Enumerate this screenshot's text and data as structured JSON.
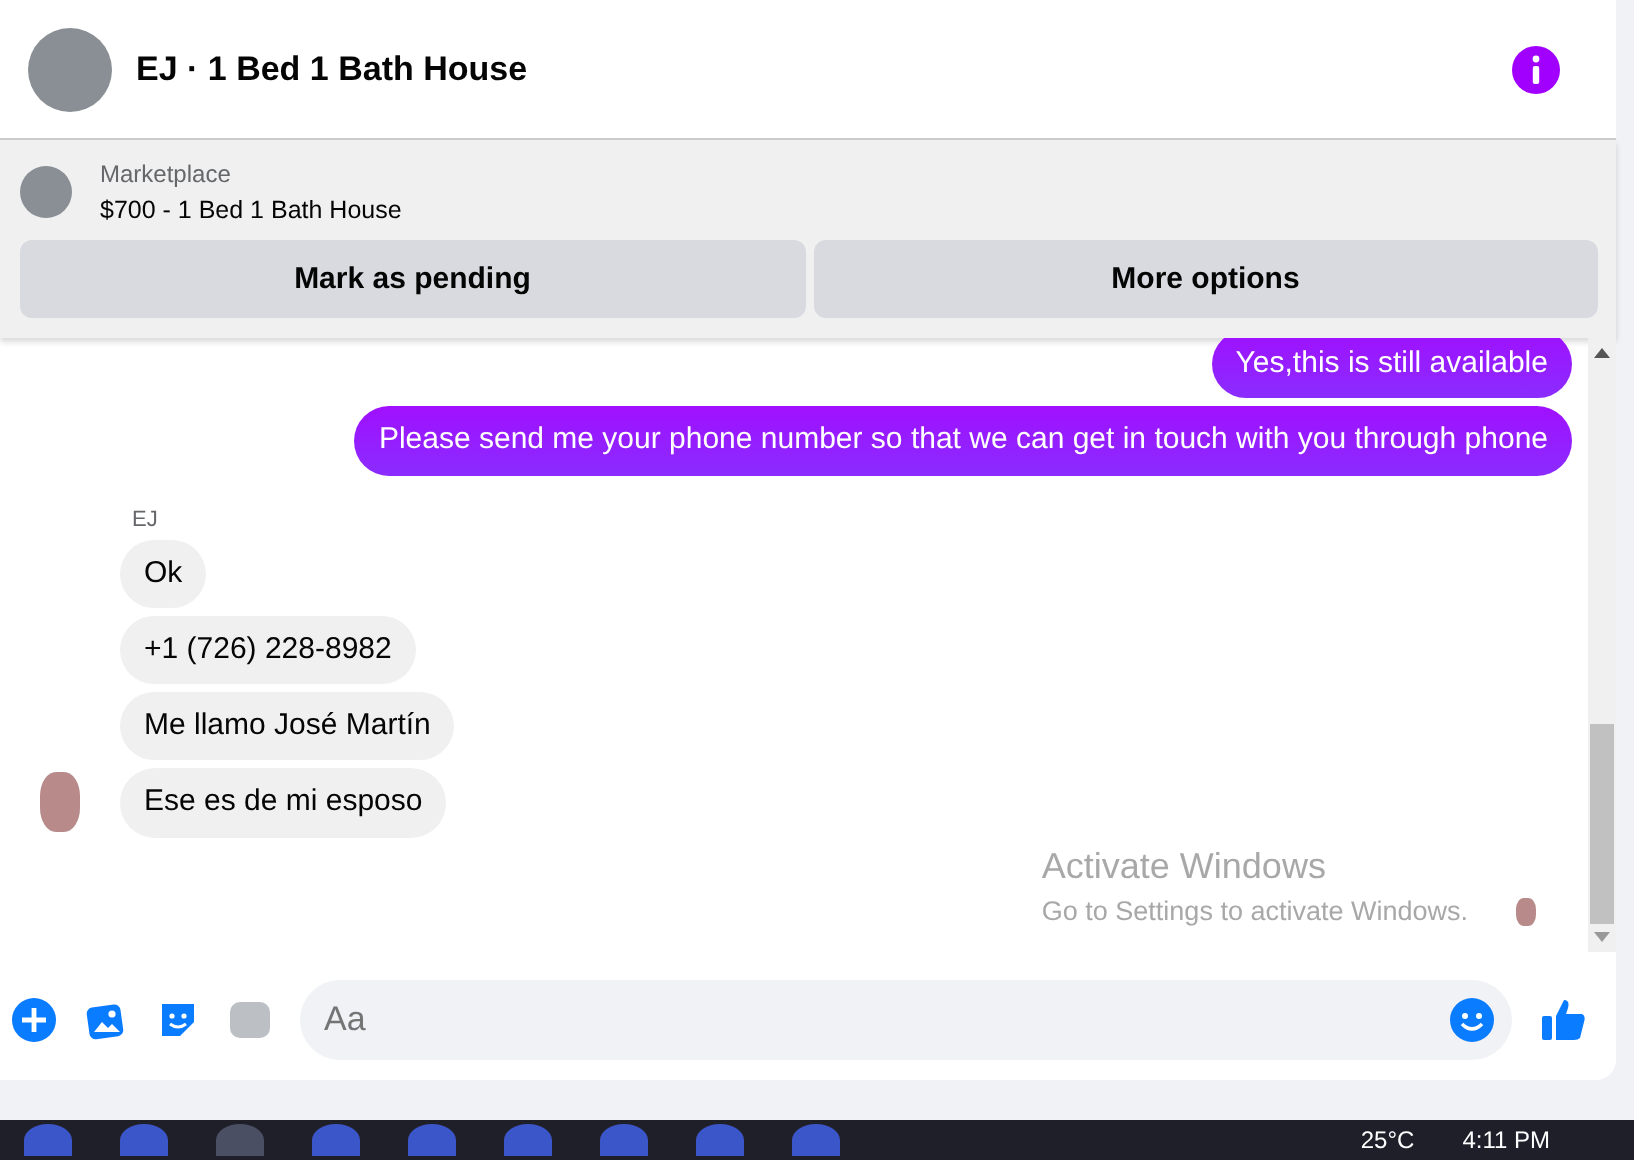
{
  "header": {
    "title": "EJ · 1 Bed 1 Bath House"
  },
  "listing": {
    "source": "Marketplace",
    "title": "$700 - 1 Bed 1 Bath House",
    "buttons": [
      "Mark as pending",
      "More options"
    ]
  },
  "messages": [
    {
      "kind": "sent",
      "text": "Yes,this is still available"
    },
    {
      "kind": "sent",
      "text": "Please send me your phone  number so that we can get in touch with you through phone"
    },
    {
      "kind": "sender",
      "text": "EJ"
    },
    {
      "kind": "received",
      "text": "Ok",
      "avatar": false
    },
    {
      "kind": "received",
      "text": "+1 (726) 228-8982",
      "avatar": false
    },
    {
      "kind": "received",
      "text": "Me llamo José Martín",
      "avatar": false
    },
    {
      "kind": "received",
      "text": "Ese es de mi esposo",
      "avatar": true
    }
  ],
  "composer": {
    "placeholder": "Aa"
  },
  "activation": {
    "title": "Activate Windows",
    "subtitle": "Go to Settings to activate Windows."
  },
  "taskbar": {
    "temperature": "25°C",
    "time": "4:11 PM"
  }
}
